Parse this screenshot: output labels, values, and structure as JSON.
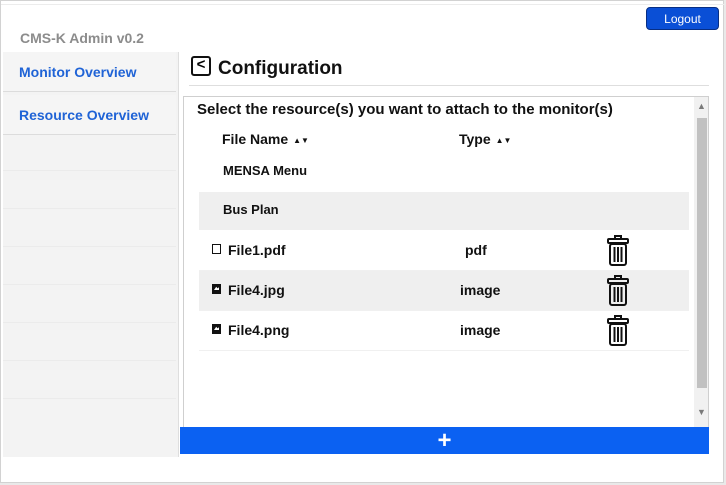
{
  "app": {
    "title": "CMS-K Admin v0.2",
    "logout_label": "Logout"
  },
  "sidebar": {
    "items": [
      {
        "label": "Monitor Overview"
      },
      {
        "label": "Resource Overview"
      }
    ]
  },
  "page": {
    "back_label": "<",
    "title": "Configuration"
  },
  "panel": {
    "heading": "Select the resource(s) you want to attach to the monitor(s)",
    "columns": {
      "file_name": "File Name",
      "type": "Type",
      "sort_glyph": "▲▼"
    },
    "folders": [
      {
        "name": "MENSA Menu"
      },
      {
        "name": "Bus Plan"
      }
    ],
    "files": [
      {
        "name": "File1.pdf",
        "type": "pdf",
        "icon": "document-icon"
      },
      {
        "name": "File4.jpg",
        "type": "image",
        "icon": "image-icon"
      },
      {
        "name": "File4.png",
        "type": "image",
        "icon": "image-icon"
      }
    ],
    "add_label": "+"
  },
  "colors": {
    "accent": "#0b61f2",
    "logout": "#0a4fd6",
    "nav_link": "#1f63d6"
  }
}
